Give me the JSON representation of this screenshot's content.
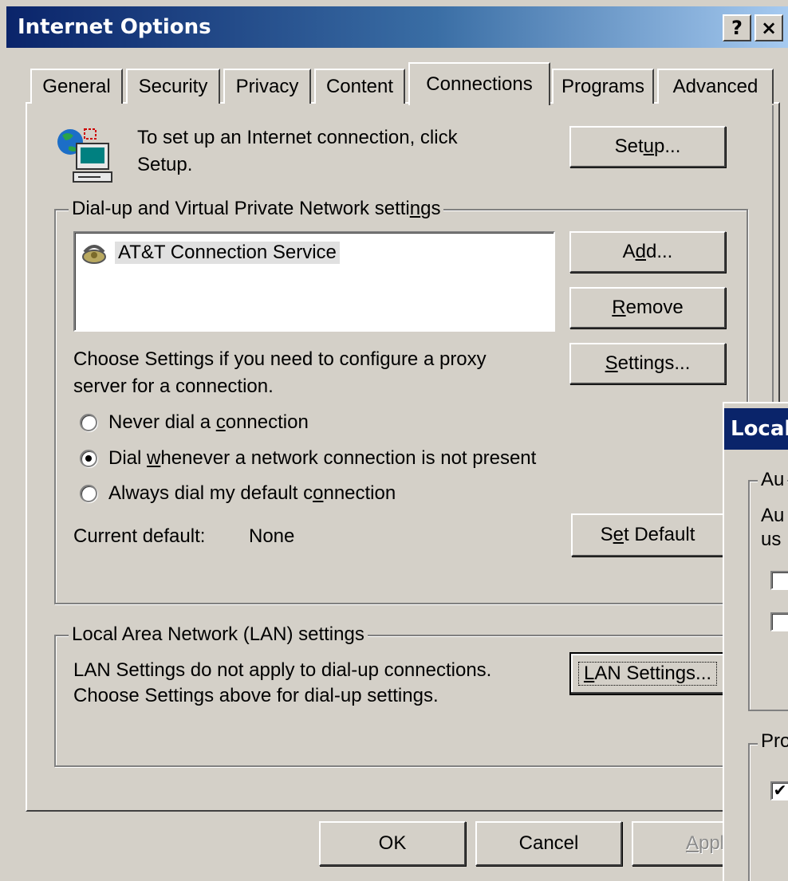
{
  "window": {
    "title": "Internet Options",
    "help_button": "?",
    "close_button": "×"
  },
  "tabs": [
    {
      "label": "General",
      "active": false
    },
    {
      "label": "Security",
      "active": false
    },
    {
      "label": "Privacy",
      "active": false
    },
    {
      "label": "Content",
      "active": false
    },
    {
      "label": "Connections",
      "active": true
    },
    {
      "label": "Programs",
      "active": false
    },
    {
      "label": "Advanced",
      "active": false
    }
  ],
  "setup": {
    "text_line1": "To set up an Internet connection, click",
    "text_line2": "Setup.",
    "button_pre": "Set",
    "button_u": "u",
    "button_post": "p...",
    "icon": "network-globe-computer-icon"
  },
  "dialup": {
    "group_title_pre": "Dial-up and Virtual Private Network setti",
    "group_title_u": "n",
    "group_title_post": "gs",
    "connections": [
      {
        "label": "AT&T Connection Service",
        "icon": "phone-connection-icon",
        "selected": true
      }
    ],
    "add_pre": "A",
    "add_u": "d",
    "add_post": "d...",
    "remove_u": "R",
    "remove_post": "emove",
    "settings_u": "S",
    "settings_post": "ettings...",
    "proxy_line1": "Choose Settings if you need to configure a proxy",
    "proxy_line2": "server for a connection.",
    "radios": [
      {
        "pre": "Never dial a ",
        "u": "c",
        "post": "onnection",
        "checked": false
      },
      {
        "pre": "Dial ",
        "u": "w",
        "post": "henever a network connection is not present",
        "checked": true
      },
      {
        "pre": "Always dial my default c",
        "u": "o",
        "post": "nnection",
        "checked": false
      }
    ],
    "current_default_label": "Current default:",
    "current_default_value": "None",
    "set_default_pre": "S",
    "set_default_u": "e",
    "set_default_post": "t Default"
  },
  "lan": {
    "group_title": "Local Area Network (LAN) settings",
    "text_line1": "LAN Settings do not apply to dial-up connections.",
    "text_line2": "Choose Settings above for dial-up settings.",
    "button_u": "L",
    "button_post": "AN Settings..."
  },
  "footer": {
    "ok": "OK",
    "cancel": "Cancel",
    "apply_u": "A",
    "apply_post": "ppl"
  },
  "secondary_dialog": {
    "title": "Local",
    "group1_title": "Au",
    "group1_text_line1": "Au",
    "group1_text_line2": "us",
    "group2_title": "Pro",
    "checkbox_mark": "✔",
    "checkboxes": [
      {
        "checked": false
      },
      {
        "checked": false
      },
      {
        "checked": true
      }
    ]
  },
  "colors": {
    "face": "#d4d0c8",
    "title_active": "#0a246a",
    "title_gradient_end": "#a6caf0"
  }
}
